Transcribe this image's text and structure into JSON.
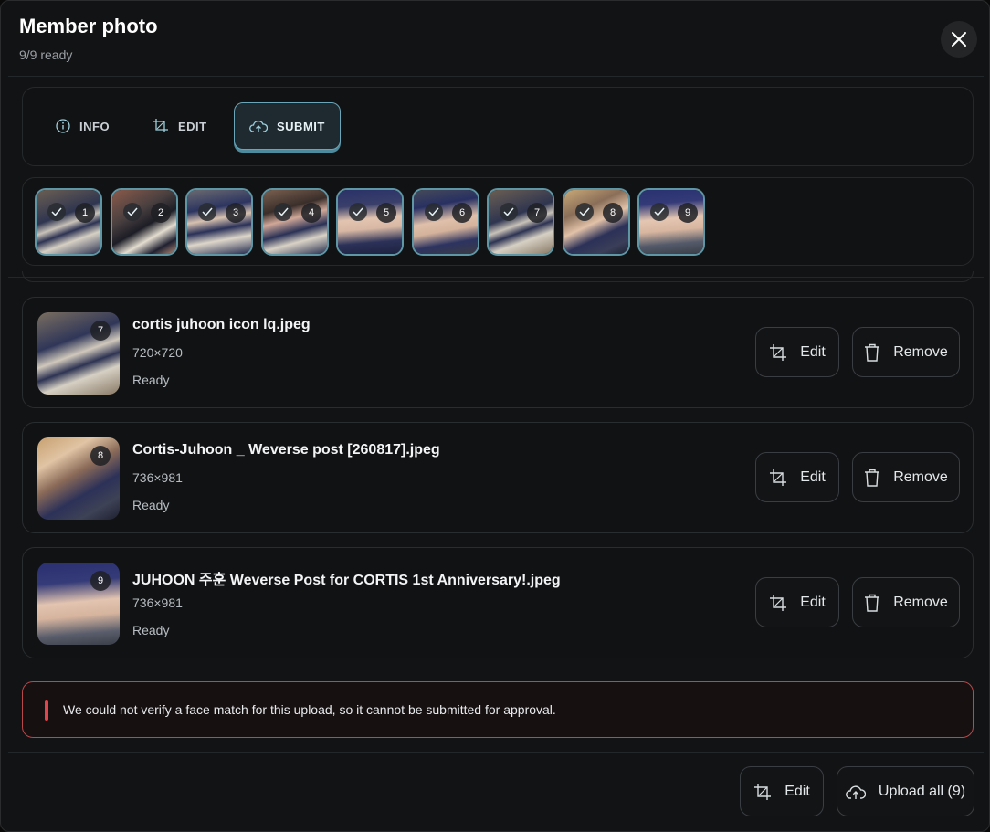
{
  "header": {
    "title": "Member photo",
    "subtitle": "9/9 ready"
  },
  "tabs": [
    {
      "label": "INFO",
      "icon": "info-icon",
      "active": false
    },
    {
      "label": "EDIT",
      "icon": "crop-icon",
      "active": false
    },
    {
      "label": "SUBMIT",
      "icon": "cloud-upload-icon",
      "active": true
    }
  ],
  "thumbnails": [
    {
      "number": "1",
      "status": "ready"
    },
    {
      "number": "2",
      "status": "ready"
    },
    {
      "number": "3",
      "status": "ready"
    },
    {
      "number": "4",
      "status": "ready"
    },
    {
      "number": "5",
      "status": "ready"
    },
    {
      "number": "6",
      "status": "ready"
    },
    {
      "number": "7",
      "status": "ready"
    },
    {
      "number": "8",
      "status": "ready"
    },
    {
      "number": "9",
      "status": "ready"
    }
  ],
  "files": [
    {
      "number": "7",
      "name": "cortis juhoon icon lq.jpeg",
      "dimensions": "720×720",
      "status": "Ready"
    },
    {
      "number": "8",
      "name": "Cortis-Juhoon _ Weverse post [260817].jpeg",
      "dimensions": "736×981",
      "status": "Ready"
    },
    {
      "number": "9",
      "name": "JUHOON 주훈 Weverse Post for CORTIS 1st Anniversary!.jpeg",
      "dimensions": "736×981",
      "status": "Ready"
    }
  ],
  "file_actions": {
    "edit_label": "Edit",
    "remove_label": "Remove"
  },
  "alert": {
    "message": "We could not verify a face match for this upload, so it cannot be submitted for approval."
  },
  "footer": {
    "edit_label": "Edit",
    "upload_label": "Upload all (9)"
  },
  "colors": {
    "accent": "#6aa5b8",
    "alert_border": "#b8484a",
    "alert_bar": "#e0474c"
  }
}
